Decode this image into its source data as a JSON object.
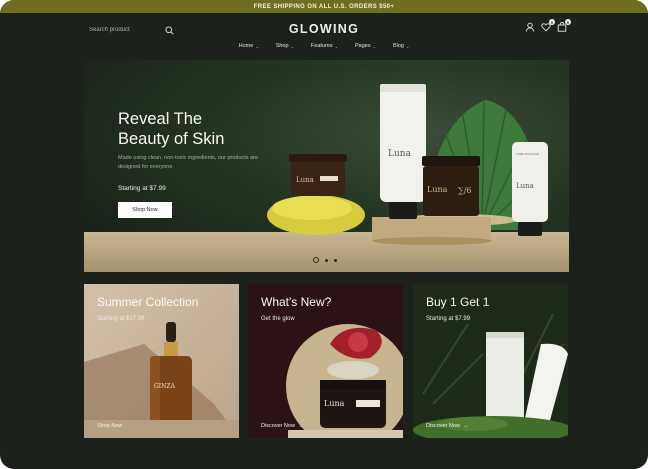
{
  "announcement": "FREE SHIPPING ON ALL U.S. ORDERS $50+",
  "search": {
    "placeholder": "Search product"
  },
  "brand": "GLOWING",
  "header_icons": {
    "account": "user-icon",
    "wishlist": "heart-icon",
    "wishlist_count": "0",
    "cart": "bag-icon",
    "cart_count": "0"
  },
  "nav": [
    {
      "label": "Home"
    },
    {
      "label": "Shop"
    },
    {
      "label": "Features"
    },
    {
      "label": "Pages"
    },
    {
      "label": "Blog"
    }
  ],
  "hero": {
    "title_line1": "Reveal The",
    "title_line2": "Beauty of Skin",
    "subtitle": "Made using clean, non-toxic ingredients, our products are designed for everyone.",
    "price": "Starting at $7.99",
    "button": "Shop Now",
    "product_labels": {
      "jar1": "Luna",
      "tube1": "Luna",
      "jar2": "Luna",
      "tube2": "Luna",
      "tube_small": "TUBE PACKAGE"
    }
  },
  "cards": [
    {
      "title": "Summer Collection",
      "sub": "Starting at $17.99",
      "link": "Shop Now",
      "bottle_label": "GINZA",
      "bg": "#c9b6a0"
    },
    {
      "title": "What's New?",
      "sub": "Get the glow",
      "link": "Discover Now",
      "jar_label": "Luna",
      "bg": "#2b1215"
    },
    {
      "title": "Buy 1 Get 1",
      "sub": "Starting at $7.99",
      "link": "Discover Now",
      "bg": "#1d2a1a"
    }
  ],
  "colors": {
    "topbar": "#6f6d1e",
    "background": "#1c211c",
    "accent": "#f2f2ea"
  }
}
